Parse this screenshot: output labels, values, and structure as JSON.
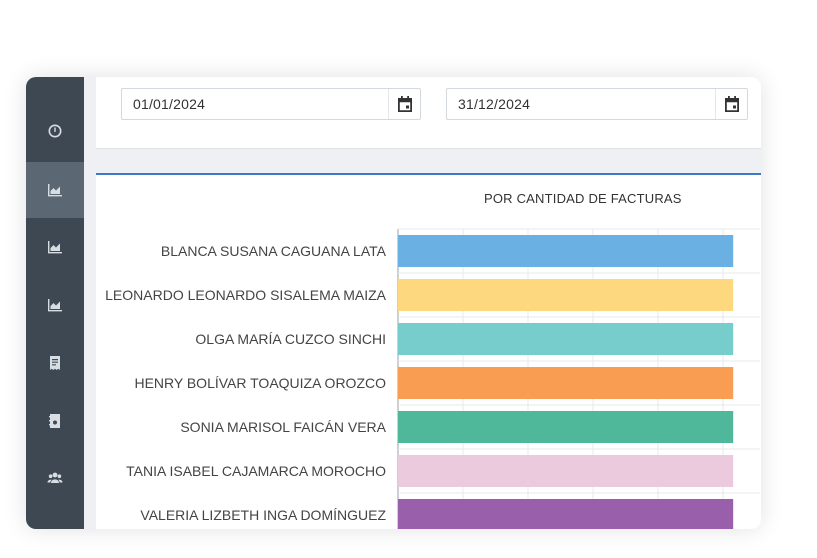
{
  "sidebar": {
    "items": [
      {
        "icon": "dashboard-icon",
        "active": false
      },
      {
        "icon": "area-chart-icon",
        "active": true
      },
      {
        "icon": "area-chart-icon",
        "active": false
      },
      {
        "icon": "area-chart-icon",
        "active": false
      },
      {
        "icon": "receipt-icon",
        "active": false
      },
      {
        "icon": "contact-book-icon",
        "active": false
      },
      {
        "icon": "users-icon",
        "active": false
      }
    ]
  },
  "filters": {
    "start_date": "01/01/2024",
    "end_date": "31/12/2024"
  },
  "chart_data": {
    "type": "bar",
    "orientation": "horizontal",
    "title": "POR CANTIDAD DE FACTURAS",
    "categories": [
      "BLANCA SUSANA CAGUANA LATA",
      "LEONARDO LEONARDO SISALEMA MAIZA",
      "OLGA MARÍA CUZCO SINCHI",
      "HENRY BOLÍVAR TOAQUIZA OROZCO",
      "SONIA MARISOL FAICÁN VERA",
      "TANIA ISABEL CAJAMARCA MOROCHO",
      "VALERIA LIZBETH INGA DOMÍNGUEZ"
    ],
    "values": [
      1,
      1,
      1,
      1,
      1,
      1,
      1
    ],
    "xlim": [
      0,
      1.08
    ],
    "colors": [
      "#6ab0e2",
      "#fdd87e",
      "#77cccc",
      "#f89d52",
      "#4fb79a",
      "#eccade",
      "#9a5faa"
    ],
    "grid": true
  }
}
